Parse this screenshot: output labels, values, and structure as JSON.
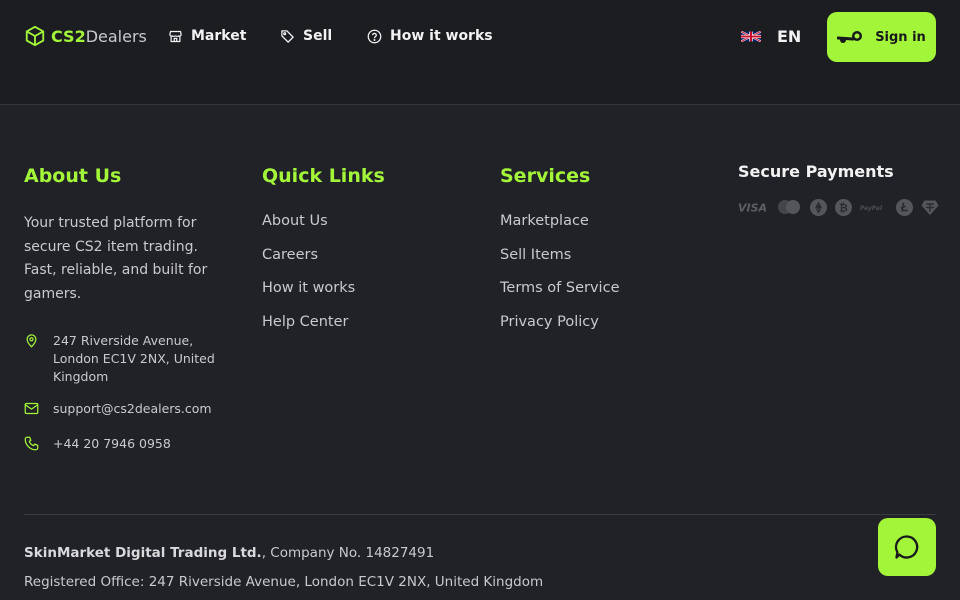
{
  "header": {
    "logo": {
      "part1": "CS2",
      "part2": "Dealers"
    },
    "nav": [
      {
        "label": "Market",
        "icon": "store-icon"
      },
      {
        "label": "Sell",
        "icon": "tag-icon"
      },
      {
        "label": "How it works",
        "icon": "help-circle-icon"
      }
    ],
    "language": "EN",
    "signin_label": "Sign in"
  },
  "footer": {
    "about": {
      "title": "About Us",
      "text": "Your trusted platform for secure CS2 item trading. Fast, reliable, and built for gamers.",
      "address": "247 Riverside Avenue, London EC1V 2NX, United Kingdom",
      "email": "support@cs2dealers.com",
      "phone": "+44 20 7946 0958"
    },
    "quick_links": {
      "title": "Quick Links",
      "items": [
        "About Us",
        "Careers",
        "How it works",
        "Help Center"
      ]
    },
    "services": {
      "title": "Services",
      "items": [
        "Marketplace",
        "Sell Items",
        "Terms of Service",
        "Privacy Policy"
      ]
    },
    "secure_payments": {
      "title": "Secure Payments",
      "methods": [
        "visa",
        "mastercard",
        "ethereum",
        "bitcoin",
        "paypal",
        "litecoin",
        "tether"
      ],
      "visa_label": "VISA",
      "paypal_label": "PayPal"
    },
    "legal": {
      "company": "SkinMarket Digital Trading Ltd.",
      "company_no": ", Company No. 14827491",
      "office": "Registered Office: 247 Riverside Avenue, London EC1V 2NX, United Kingdom"
    }
  },
  "colors": {
    "accent": "#a3f53a",
    "background": "#212227",
    "header": "#1c1d21"
  }
}
